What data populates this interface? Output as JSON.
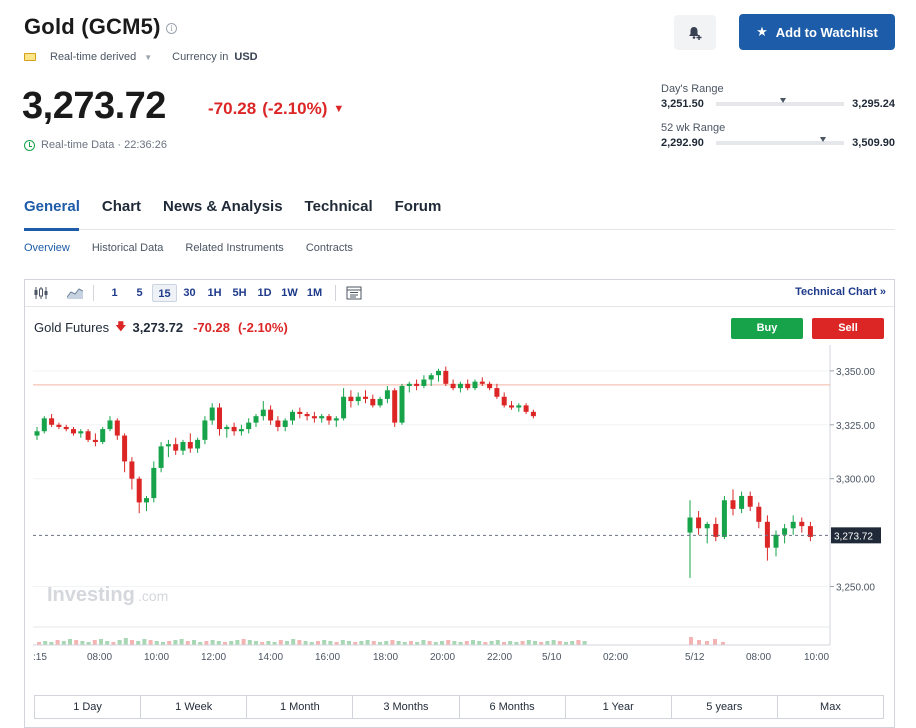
{
  "header": {
    "title": "Gold (GCM5)",
    "feed_label": "Real-time derived",
    "currency_label": "Currency in",
    "currency_value": "USD",
    "price": "3,273.72",
    "change": "-70.28",
    "change_pct": "(-2.10%)",
    "realtime_text": "Real-time Data · 22:36:26",
    "watchlist_label": "Add to Watchlist"
  },
  "ranges": {
    "day": {
      "label": "Day's Range",
      "low": "3,251.50",
      "high": "3,295.24",
      "position": 0.5
    },
    "week52": {
      "label": "52 wk Range",
      "low": "2,292.90",
      "high": "3,509.90",
      "position": 0.81
    }
  },
  "tabs": [
    "General",
    "Chart",
    "News & Analysis",
    "Technical",
    "Forum"
  ],
  "subtabs": [
    "Overview",
    "Historical Data",
    "Related Instruments",
    "Contracts"
  ],
  "toolbar": {
    "timeframes": [
      "1",
      "5",
      "15",
      "30",
      "1H",
      "5H",
      "1D",
      "1W",
      "1M"
    ],
    "active_timeframe": "15",
    "tech_link": "Technical Chart »"
  },
  "chart_head": {
    "name": "Gold Futures",
    "price": "3,273.72",
    "change": "-70.28",
    "change_pct": "(-2.10%)",
    "buy": "Buy",
    "sell": "Sell"
  },
  "chart_data": {
    "type": "candlestick",
    "y_ticks": [
      "3,350.00",
      "3,325.00",
      "3,300.00",
      "3,250.00"
    ],
    "y_tick_values": [
      3350,
      3325,
      3300,
      3250
    ],
    "ylim": [
      3234,
      3362
    ],
    "last_price_label": "3,273.72",
    "last_price": 3273.72,
    "reference_line": 3343.5,
    "x_labels": [
      ":15",
      "08:00",
      "10:00",
      "12:00",
      "14:00",
      "16:00",
      "18:00",
      "20:00",
      "22:00",
      "5/10",
      "02:00",
      "5/12",
      "08:00",
      "10:00"
    ],
    "watermark": "Investing",
    "watermark_suffix": ".com",
    "candles_session1": [
      [
        3320,
        3324,
        3318,
        3322
      ],
      [
        3322,
        3329,
        3321,
        3328
      ],
      [
        3328,
        3330,
        3324,
        3325
      ],
      [
        3325,
        3326,
        3323,
        3324
      ],
      [
        3324,
        3325,
        3322,
        3323
      ],
      [
        3323,
        3324,
        3320,
        3321
      ],
      [
        3321,
        3323,
        3319,
        3322
      ],
      [
        3322,
        3323,
        3317,
        3318
      ],
      [
        3318,
        3321,
        3315,
        3317
      ],
      [
        3317,
        3324,
        3316,
        3323
      ],
      [
        3323,
        3329,
        3322,
        3327
      ],
      [
        3327,
        3328,
        3318,
        3320
      ],
      [
        3320,
        3321,
        3303,
        3308
      ],
      [
        3308,
        3310,
        3295,
        3300
      ],
      [
        3300,
        3301,
        3284,
        3289
      ],
      [
        3289,
        3292,
        3285,
        3291
      ],
      [
        3291,
        3308,
        3289,
        3305
      ],
      [
        3305,
        3317,
        3303,
        3315
      ],
      [
        3315,
        3318,
        3310,
        3316
      ],
      [
        3316,
        3319,
        3311,
        3313
      ],
      [
        3313,
        3318,
        3311,
        3317
      ],
      [
        3317,
        3321,
        3312,
        3314
      ],
      [
        3314,
        3319,
        3312,
        3318
      ],
      [
        3318,
        3329,
        3316,
        3327
      ],
      [
        3327,
        3335,
        3325,
        3333
      ],
      [
        3333,
        3335,
        3320,
        3323
      ],
      [
        3323,
        3325,
        3319,
        3324
      ],
      [
        3324,
        3326,
        3320,
        3322
      ],
      [
        3322,
        3325,
        3320,
        3323
      ],
      [
        3323,
        3328,
        3321,
        3326
      ],
      [
        3326,
        3330,
        3324,
        3329
      ],
      [
        3329,
        3336,
        3327,
        3332
      ],
      [
        3332,
        3334,
        3325,
        3327
      ],
      [
        3327,
        3329,
        3322,
        3324
      ],
      [
        3324,
        3328,
        3322,
        3327
      ],
      [
        3327,
        3332,
        3325,
        3331
      ],
      [
        3331,
        3333,
        3328,
        3330
      ],
      [
        3330,
        3331,
        3327,
        3329
      ],
      [
        3329,
        3331,
        3326,
        3328
      ],
      [
        3328,
        3330,
        3326,
        3329
      ],
      [
        3329,
        3330,
        3325,
        3327
      ],
      [
        3327,
        3329,
        3324,
        3328
      ],
      [
        3328,
        3342,
        3327,
        3338
      ],
      [
        3338,
        3341,
        3333,
        3336
      ],
      [
        3336,
        3340,
        3334,
        3338
      ],
      [
        3338,
        3341,
        3335,
        3337
      ],
      [
        3337,
        3339,
        3333,
        3334
      ],
      [
        3334,
        3338,
        3333,
        3337
      ],
      [
        3337,
        3343,
        3335,
        3341
      ],
      [
        3341,
        3342,
        3324,
        3326
      ],
      [
        3326,
        3344,
        3325,
        3343
      ],
      [
        3343,
        3345,
        3340,
        3344
      ],
      [
        3344,
        3346,
        3341,
        3343
      ],
      [
        3343,
        3348,
        3342,
        3346
      ],
      [
        3346,
        3349,
        3343,
        3348
      ],
      [
        3348,
        3351,
        3345,
        3350
      ],
      [
        3350,
        3352,
        3343,
        3344
      ],
      [
        3344,
        3346,
        3341,
        3342
      ],
      [
        3342,
        3345,
        3340,
        3344
      ],
      [
        3344,
        3346,
        3341,
        3342
      ],
      [
        3342,
        3346,
        3341,
        3345
      ],
      [
        3345,
        3347,
        3343,
        3344
      ],
      [
        3344,
        3345,
        3341,
        3342
      ],
      [
        3342,
        3344,
        3337,
        3338
      ],
      [
        3338,
        3340,
        3333,
        3334
      ],
      [
        3334,
        3336,
        3332,
        3333
      ],
      [
        3333,
        3335,
        3331,
        3334
      ],
      [
        3334,
        3335,
        3330,
        3331
      ],
      [
        3331,
        3332,
        3328,
        3329
      ]
    ],
    "candles_session2": [
      [
        3275,
        3290,
        3254,
        3282
      ],
      [
        3282,
        3285,
        3274,
        3277
      ],
      [
        3277,
        3280,
        3270,
        3279
      ],
      [
        3279,
        3282,
        3271,
        3273
      ],
      [
        3273,
        3292,
        3272,
        3290
      ],
      [
        3290,
        3295,
        3283,
        3286
      ],
      [
        3286,
        3294,
        3284,
        3292
      ],
      [
        3292,
        3294,
        3285,
        3287
      ],
      [
        3287,
        3289,
        3277,
        3280
      ],
      [
        3280,
        3283,
        3262,
        3268
      ],
      [
        3268,
        3276,
        3264,
        3274
      ],
      [
        3274,
        3279,
        3270,
        3277
      ],
      [
        3277,
        3283,
        3274,
        3280
      ],
      [
        3280,
        3282,
        3275,
        3278
      ],
      [
        3278,
        3280,
        3271,
        3273
      ]
    ]
  },
  "periods": [
    "1 Day",
    "1 Week",
    "1 Month",
    "3 Months",
    "6 Months",
    "1 Year",
    "5 years",
    "Max"
  ]
}
